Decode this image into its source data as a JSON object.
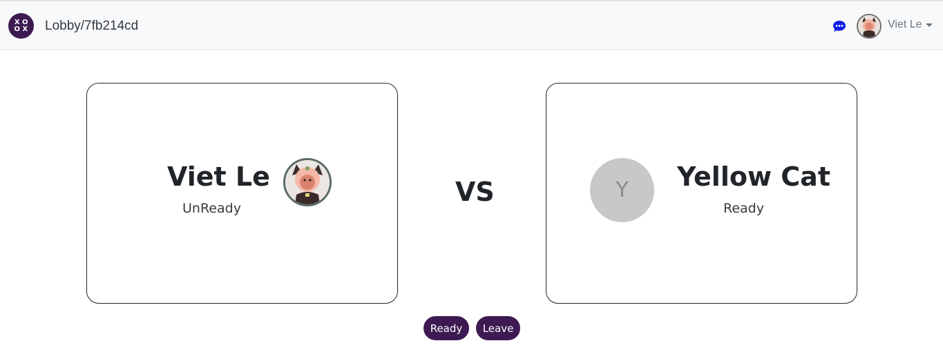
{
  "header": {
    "logo_glyphs": [
      "X",
      "O",
      "O",
      "X"
    ],
    "breadcrumb": "Lobby/7fb214cd",
    "chat_icon": "chat-bubble-icon",
    "user_name": "Viet Le"
  },
  "players": {
    "left": {
      "name": "Viet Le",
      "status": "UnReady"
    },
    "right": {
      "name": "Yellow Cat",
      "status": "Ready",
      "initial": "Y"
    }
  },
  "vs_label": "VS",
  "actions": {
    "ready_label": "Ready",
    "leave_label": "Leave"
  },
  "colors": {
    "brand": "#3d1a52",
    "chat_icon": "#0d1ee6",
    "placeholder_avatar": "#c8c8c8"
  }
}
